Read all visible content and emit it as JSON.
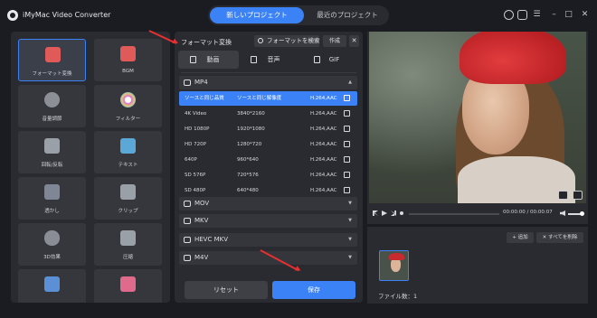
{
  "app": {
    "title": "iMyMac Video Converter"
  },
  "tabs": {
    "new_project": "新しいプロジェクト",
    "recent_projects": "最近のプロジェクト"
  },
  "tools": [
    {
      "label": "フォーマット変換",
      "icon": "format-convert-icon",
      "active": true
    },
    {
      "label": "BGM",
      "icon": "bgm-icon"
    },
    {
      "label": "音量調節",
      "icon": "volume-adjust-icon"
    },
    {
      "label": "フィルター",
      "icon": "filter-icon"
    },
    {
      "label": "回転/反転",
      "icon": "rotate-flip-icon"
    },
    {
      "label": "テキスト",
      "icon": "text-icon"
    },
    {
      "label": "透かし",
      "icon": "watermark-icon"
    },
    {
      "label": "クリップ",
      "icon": "clip-icon"
    },
    {
      "label": "3D効果",
      "icon": "3d-effect-icon"
    },
    {
      "label": "圧縮",
      "icon": "compress-icon"
    },
    {
      "label": "",
      "icon": "edit-icon"
    },
    {
      "label": "",
      "icon": "screen-record-icon"
    }
  ],
  "format_panel": {
    "title": "フォーマット変換",
    "search_label": "フォーマットを検索",
    "create_label": "作成",
    "close_label": "✕",
    "category_tabs": [
      "動画",
      "音声",
      "GIF"
    ],
    "groups": {
      "mp4": "MP4",
      "mov": "MOV",
      "mkv": "MKV",
      "hevc_mkv": "HEVC MKV",
      "m4v": "M4V"
    },
    "presets": [
      {
        "name": "ソースと同じ品質",
        "resolution": "ソースと同じ解像度",
        "codec": "H.264,AAC",
        "selected": true
      },
      {
        "name": "4K Video",
        "resolution": "3840*2160",
        "codec": "H.264,AAC"
      },
      {
        "name": "HD 1080P",
        "resolution": "1920*1080",
        "codec": "H.264,AAC"
      },
      {
        "name": "HD 720P",
        "resolution": "1280*720",
        "codec": "H.264,AAC"
      },
      {
        "name": "640P",
        "resolution": "960*640",
        "codec": "H.264,AAC"
      },
      {
        "name": "SD 576P",
        "resolution": "720*576",
        "codec": "H.264,AAC"
      },
      {
        "name": "SD 480P",
        "resolution": "640*480",
        "codec": "H.264,AAC"
      }
    ],
    "reset_label": "リセット",
    "save_label": "保存"
  },
  "player": {
    "timecode": "00:00:00 / 00:00:07"
  },
  "files": {
    "add_label": "+ 追加",
    "clear_label": "✕ すべてを削除",
    "count_label": "ファイル数：1"
  },
  "colors": {
    "accent": "#3b82f6",
    "annotation_arrow": "#e53030",
    "background": "#1b1c22",
    "panel": "#2a2b30"
  }
}
